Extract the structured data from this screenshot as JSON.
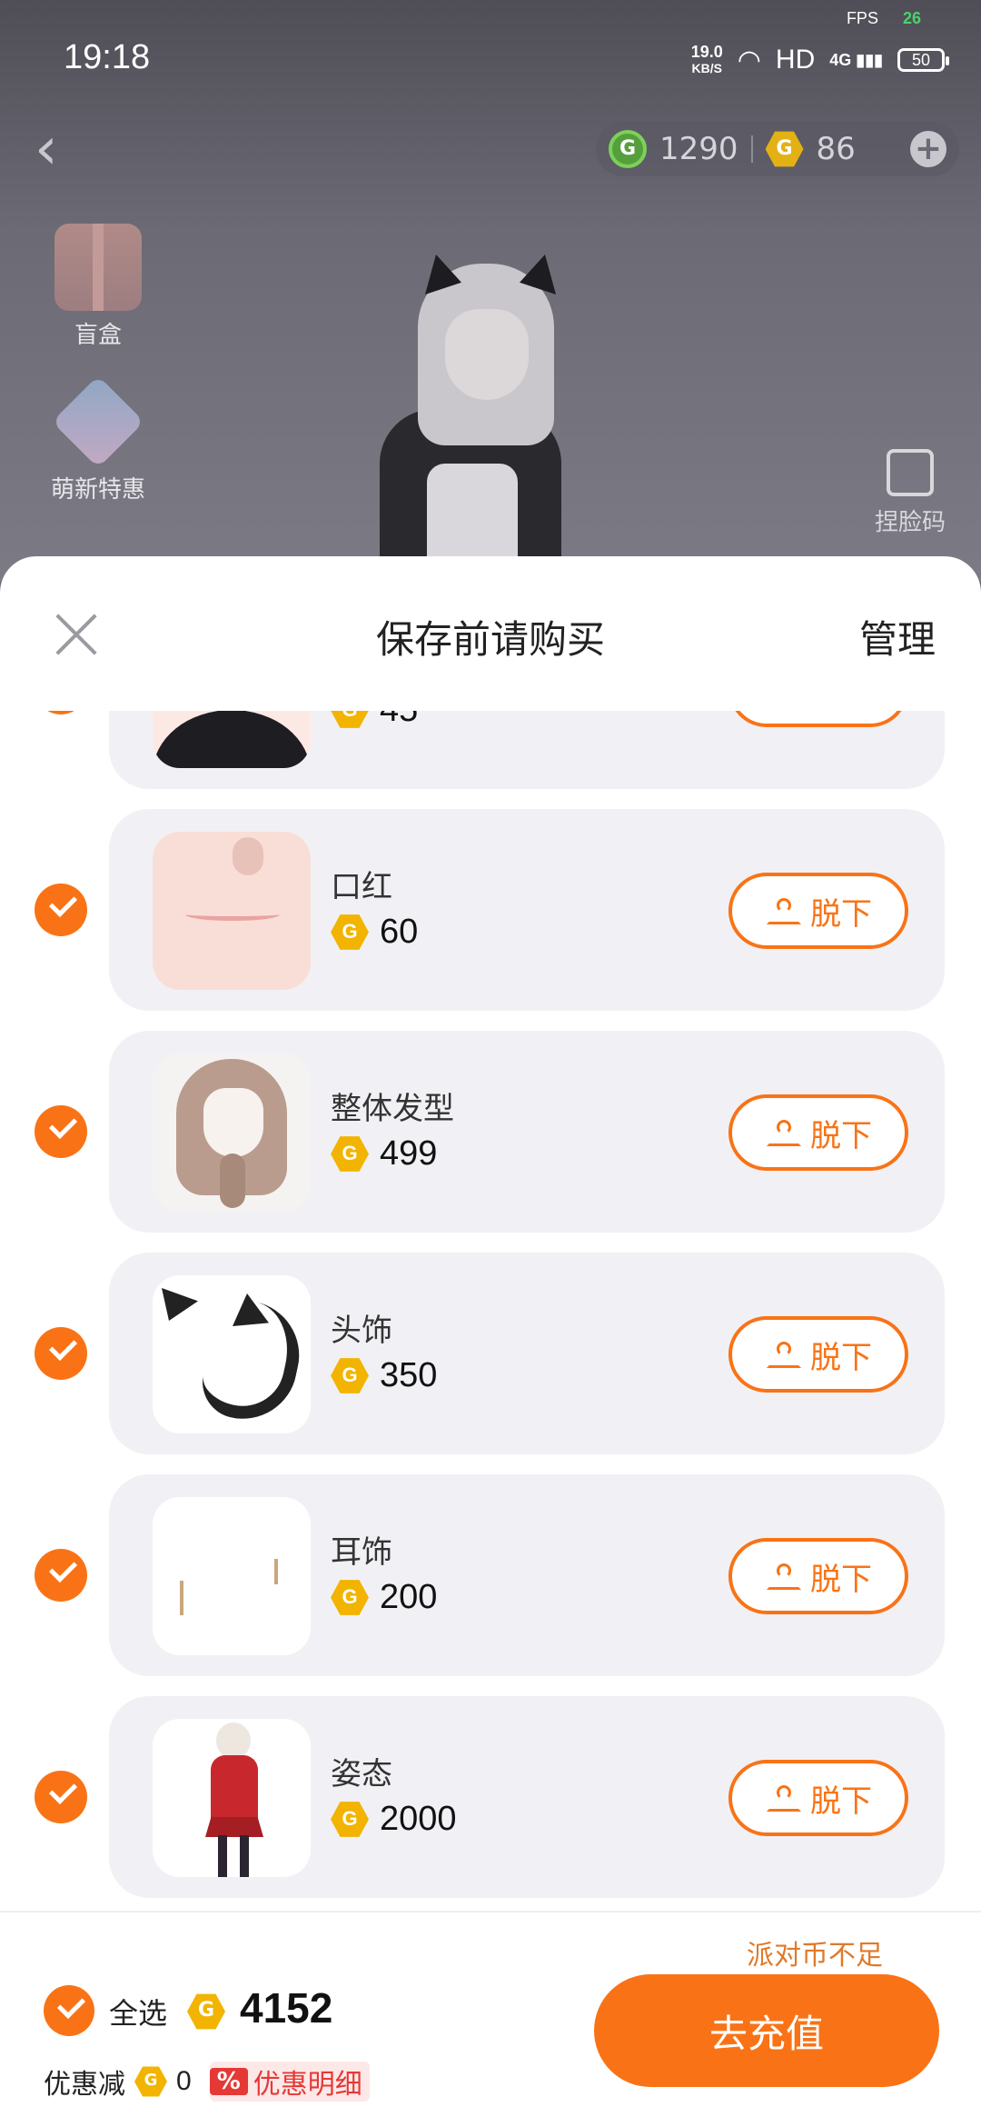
{
  "status_bar": {
    "time": "19:18",
    "fps_label": "FPS",
    "fps_value": "26",
    "speed_value": "19.0",
    "speed_unit": "KB/S",
    "hd": "HD",
    "network": "4G",
    "battery": "50"
  },
  "top_bar": {
    "green_coins": "1290",
    "gold_coins": "86",
    "coin_letter": "G"
  },
  "side_menu": [
    {
      "label": "盲盒"
    },
    {
      "label": "萌新特惠"
    }
  ],
  "face_code_label": "捏脸码",
  "sheet": {
    "title": "保存前请购买",
    "manage": "管理",
    "take_off_label": "脱下",
    "items": [
      {
        "name": "",
        "price": "45"
      },
      {
        "name": "口红",
        "price": "60"
      },
      {
        "name": "整体发型",
        "price": "499"
      },
      {
        "name": "头饰",
        "price": "350"
      },
      {
        "name": "耳饰",
        "price": "200"
      },
      {
        "name": "姿态",
        "price": "2000"
      }
    ]
  },
  "footer": {
    "insufficient": "派对币不足",
    "select_all": "全选",
    "total": "4152",
    "discount_label": "优惠减",
    "discount_value": "0",
    "discount_icon": "%",
    "discount_detail": "优惠明细",
    "recharge": "去充值"
  },
  "colors": {
    "accent": "#f97316",
    "coin": "#f2b400",
    "discount": "#e53935"
  }
}
